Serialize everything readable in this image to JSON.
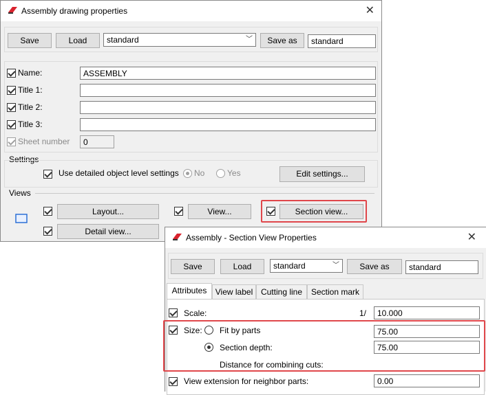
{
  "main_window": {
    "title": "Assembly drawing properties",
    "toolbar": {
      "save": "Save",
      "load": "Load",
      "preset": "standard",
      "save_as": "Save as",
      "save_as_name": "standard"
    },
    "fields": [
      {
        "label": "Name:",
        "value": "ASSEMBLY"
      },
      {
        "label": "Title 1:",
        "value": ""
      },
      {
        "label": "Title 2:",
        "value": ""
      },
      {
        "label": "Title 3:",
        "value": ""
      }
    ],
    "sheet_number": {
      "label": "Sheet number",
      "value": "0"
    },
    "settings": {
      "heading": "Settings",
      "use_detailed": "Use detailed object level settings",
      "no": "No",
      "yes": "Yes",
      "edit_settings": "Edit settings..."
    },
    "views": {
      "heading": "Views",
      "layout": "Layout...",
      "view": "View...",
      "section_view": "Section view...",
      "detail_view": "Detail view..."
    }
  },
  "section_window": {
    "title": "Assembly - Section View Properties",
    "toolbar": {
      "save": "Save",
      "load": "Load",
      "preset": "standard",
      "save_as": "Save as",
      "save_as_name": "standard"
    },
    "tabs": [
      "Attributes",
      "View label",
      "Cutting line",
      "Section mark"
    ],
    "scale": {
      "label": "Scale:",
      "prefix": "1/",
      "value": "10.000"
    },
    "size": {
      "label": "Size:",
      "fit_by_parts": "Fit by parts",
      "fit_value": "75.00",
      "section_depth": "Section depth:",
      "depth_value": "75.00",
      "combining": "Distance for combining cuts:"
    },
    "extension": {
      "label": "View extension for neighbor parts:",
      "value": "0.00"
    }
  },
  "colors": {
    "highlight": "#e0464a",
    "window_bg": "#f0f0f0"
  }
}
